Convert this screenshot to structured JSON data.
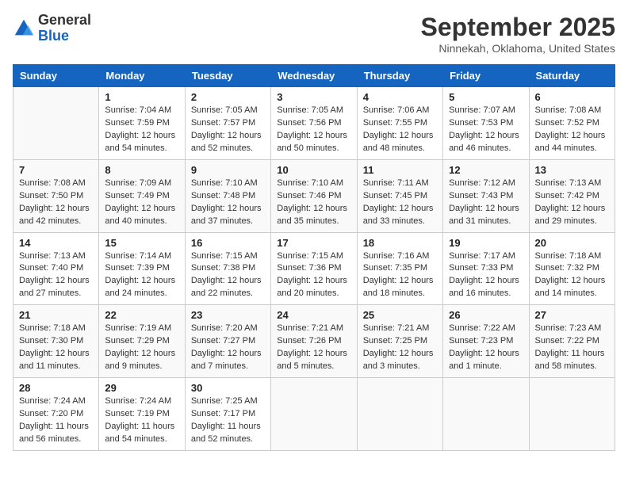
{
  "header": {
    "logo_general": "General",
    "logo_blue": "Blue",
    "month": "September 2025",
    "location": "Ninnekah, Oklahoma, United States"
  },
  "weekdays": [
    "Sunday",
    "Monday",
    "Tuesday",
    "Wednesday",
    "Thursday",
    "Friday",
    "Saturday"
  ],
  "weeks": [
    [
      {
        "day": "",
        "info": ""
      },
      {
        "day": "1",
        "info": "Sunrise: 7:04 AM\nSunset: 7:59 PM\nDaylight: 12 hours\nand 54 minutes."
      },
      {
        "day": "2",
        "info": "Sunrise: 7:05 AM\nSunset: 7:57 PM\nDaylight: 12 hours\nand 52 minutes."
      },
      {
        "day": "3",
        "info": "Sunrise: 7:05 AM\nSunset: 7:56 PM\nDaylight: 12 hours\nand 50 minutes."
      },
      {
        "day": "4",
        "info": "Sunrise: 7:06 AM\nSunset: 7:55 PM\nDaylight: 12 hours\nand 48 minutes."
      },
      {
        "day": "5",
        "info": "Sunrise: 7:07 AM\nSunset: 7:53 PM\nDaylight: 12 hours\nand 46 minutes."
      },
      {
        "day": "6",
        "info": "Sunrise: 7:08 AM\nSunset: 7:52 PM\nDaylight: 12 hours\nand 44 minutes."
      }
    ],
    [
      {
        "day": "7",
        "info": "Sunrise: 7:08 AM\nSunset: 7:50 PM\nDaylight: 12 hours\nand 42 minutes."
      },
      {
        "day": "8",
        "info": "Sunrise: 7:09 AM\nSunset: 7:49 PM\nDaylight: 12 hours\nand 40 minutes."
      },
      {
        "day": "9",
        "info": "Sunrise: 7:10 AM\nSunset: 7:48 PM\nDaylight: 12 hours\nand 37 minutes."
      },
      {
        "day": "10",
        "info": "Sunrise: 7:10 AM\nSunset: 7:46 PM\nDaylight: 12 hours\nand 35 minutes."
      },
      {
        "day": "11",
        "info": "Sunrise: 7:11 AM\nSunset: 7:45 PM\nDaylight: 12 hours\nand 33 minutes."
      },
      {
        "day": "12",
        "info": "Sunrise: 7:12 AM\nSunset: 7:43 PM\nDaylight: 12 hours\nand 31 minutes."
      },
      {
        "day": "13",
        "info": "Sunrise: 7:13 AM\nSunset: 7:42 PM\nDaylight: 12 hours\nand 29 minutes."
      }
    ],
    [
      {
        "day": "14",
        "info": "Sunrise: 7:13 AM\nSunset: 7:40 PM\nDaylight: 12 hours\nand 27 minutes."
      },
      {
        "day": "15",
        "info": "Sunrise: 7:14 AM\nSunset: 7:39 PM\nDaylight: 12 hours\nand 24 minutes."
      },
      {
        "day": "16",
        "info": "Sunrise: 7:15 AM\nSunset: 7:38 PM\nDaylight: 12 hours\nand 22 minutes."
      },
      {
        "day": "17",
        "info": "Sunrise: 7:15 AM\nSunset: 7:36 PM\nDaylight: 12 hours\nand 20 minutes."
      },
      {
        "day": "18",
        "info": "Sunrise: 7:16 AM\nSunset: 7:35 PM\nDaylight: 12 hours\nand 18 minutes."
      },
      {
        "day": "19",
        "info": "Sunrise: 7:17 AM\nSunset: 7:33 PM\nDaylight: 12 hours\nand 16 minutes."
      },
      {
        "day": "20",
        "info": "Sunrise: 7:18 AM\nSunset: 7:32 PM\nDaylight: 12 hours\nand 14 minutes."
      }
    ],
    [
      {
        "day": "21",
        "info": "Sunrise: 7:18 AM\nSunset: 7:30 PM\nDaylight: 12 hours\nand 11 minutes."
      },
      {
        "day": "22",
        "info": "Sunrise: 7:19 AM\nSunset: 7:29 PM\nDaylight: 12 hours\nand 9 minutes."
      },
      {
        "day": "23",
        "info": "Sunrise: 7:20 AM\nSunset: 7:27 PM\nDaylight: 12 hours\nand 7 minutes."
      },
      {
        "day": "24",
        "info": "Sunrise: 7:21 AM\nSunset: 7:26 PM\nDaylight: 12 hours\nand 5 minutes."
      },
      {
        "day": "25",
        "info": "Sunrise: 7:21 AM\nSunset: 7:25 PM\nDaylight: 12 hours\nand 3 minutes."
      },
      {
        "day": "26",
        "info": "Sunrise: 7:22 AM\nSunset: 7:23 PM\nDaylight: 12 hours\nand 1 minute."
      },
      {
        "day": "27",
        "info": "Sunrise: 7:23 AM\nSunset: 7:22 PM\nDaylight: 11 hours\nand 58 minutes."
      }
    ],
    [
      {
        "day": "28",
        "info": "Sunrise: 7:24 AM\nSunset: 7:20 PM\nDaylight: 11 hours\nand 56 minutes."
      },
      {
        "day": "29",
        "info": "Sunrise: 7:24 AM\nSunset: 7:19 PM\nDaylight: 11 hours\nand 54 minutes."
      },
      {
        "day": "30",
        "info": "Sunrise: 7:25 AM\nSunset: 7:17 PM\nDaylight: 11 hours\nand 52 minutes."
      },
      {
        "day": "",
        "info": ""
      },
      {
        "day": "",
        "info": ""
      },
      {
        "day": "",
        "info": ""
      },
      {
        "day": "",
        "info": ""
      }
    ]
  ]
}
